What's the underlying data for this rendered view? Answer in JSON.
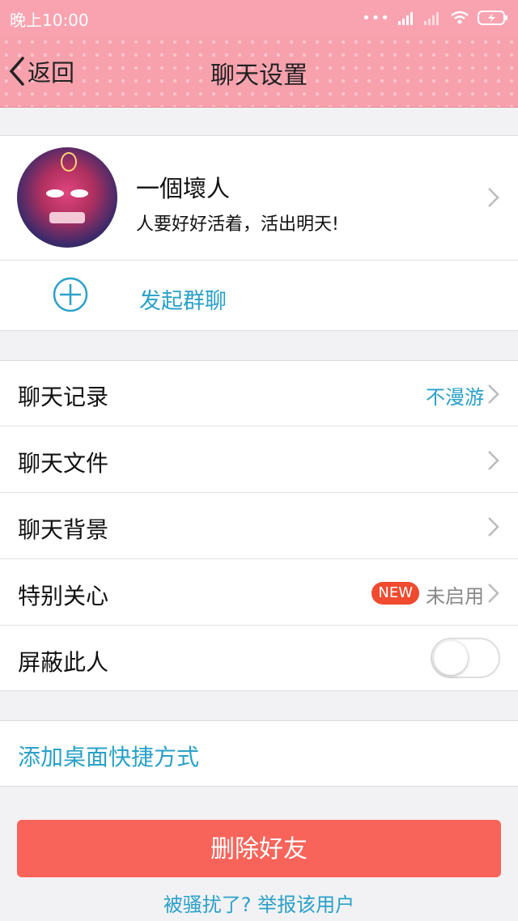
{
  "status_bar": {
    "time": "晚上10:00"
  },
  "nav": {
    "back_label": "返回",
    "title": "聊天设置"
  },
  "profile": {
    "name": "一個壞人",
    "signature": "人要好好活着，活出明天!",
    "group_chat_label": "发起群聊"
  },
  "settings": [
    {
      "label": "聊天记录",
      "value": "不漫游",
      "value_color": "#2aa1c8"
    },
    {
      "label": "聊天文件",
      "value": ""
    },
    {
      "label": "聊天背景",
      "value": ""
    },
    {
      "label": "特别关心",
      "badge": "NEW",
      "value": "未启用",
      "value_color": "#888888"
    },
    {
      "label": "屏蔽此人",
      "toggle_on": false
    }
  ],
  "shortcut_label": "添加桌面快捷方式",
  "delete_label": "删除好友",
  "report_label": "被骚扰了? 举报该用户",
  "colors": {
    "accent": "#2aa1c8",
    "nav_pink": "#f7a1ad",
    "danger": "#f9645a",
    "badge": "#f04a2f"
  }
}
